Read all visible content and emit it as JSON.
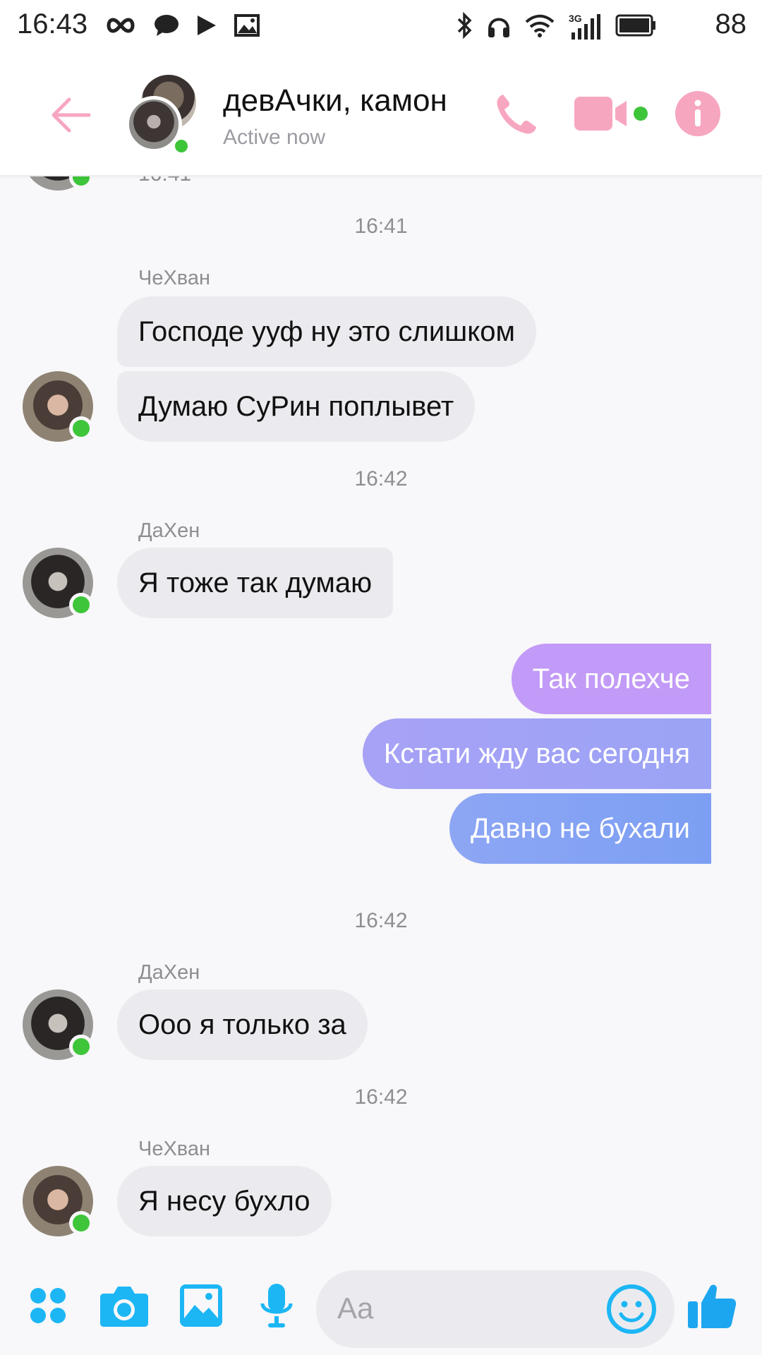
{
  "status_bar": {
    "time": "16:43",
    "battery_percent": "88",
    "network_label": "3G",
    "left_icons": [
      "infinity-icon",
      "chat-bubble-icon",
      "play-icon",
      "image-icon"
    ],
    "right_icons": [
      "bluetooth-icon",
      "headphones-icon",
      "wifi-icon",
      "signal-3g-icon",
      "battery-icon"
    ]
  },
  "header": {
    "title": "девАчки, камон",
    "subtitle": "Active now",
    "icons": [
      "back-arrow-icon",
      "phone-icon",
      "video-camera-icon",
      "info-icon"
    ],
    "accent_color": "#f7a6c0",
    "online_color": "#3ec53a"
  },
  "messages": [
    {
      "type": "timestamp",
      "text": "16:41"
    },
    {
      "type": "timestamp",
      "text": "16:41"
    },
    {
      "type": "sender",
      "text": "ЧеХван"
    },
    {
      "type": "incoming",
      "text": "Господе ууф ну это слишком"
    },
    {
      "type": "incoming",
      "text": "Думаю СуРин поплывет"
    },
    {
      "type": "timestamp",
      "text": "16:42"
    },
    {
      "type": "sender",
      "text": "ДаХен"
    },
    {
      "type": "incoming",
      "text": "Я тоже так думаю"
    },
    {
      "type": "outgoing",
      "text": "Так полехче"
    },
    {
      "type": "outgoing",
      "text": "Кстати жду вас сегодня"
    },
    {
      "type": "outgoing",
      "text": "Давно не бухали"
    },
    {
      "type": "timestamp",
      "text": "16:42"
    },
    {
      "type": "sender",
      "text": "ДаХен"
    },
    {
      "type": "incoming",
      "text": "Ооо я только за"
    },
    {
      "type": "timestamp",
      "text": "16:42"
    },
    {
      "type": "sender",
      "text": "ЧеХван"
    },
    {
      "type": "incoming",
      "text": "Я несу бухло"
    }
  ],
  "colors": {
    "incoming_bubble": "#ebebef",
    "outgoing_gradient_top": "#c29af7",
    "outgoing_gradient_bottom": "#7c9ff3",
    "composer_icon": "#1cb6f5",
    "like_icon": "#1ca6f0"
  },
  "composer": {
    "placeholder": "Aa",
    "icons": [
      "apps-grid-icon",
      "camera-icon",
      "gallery-icon",
      "microphone-icon",
      "emoji-icon",
      "thumbs-up-icon"
    ]
  }
}
